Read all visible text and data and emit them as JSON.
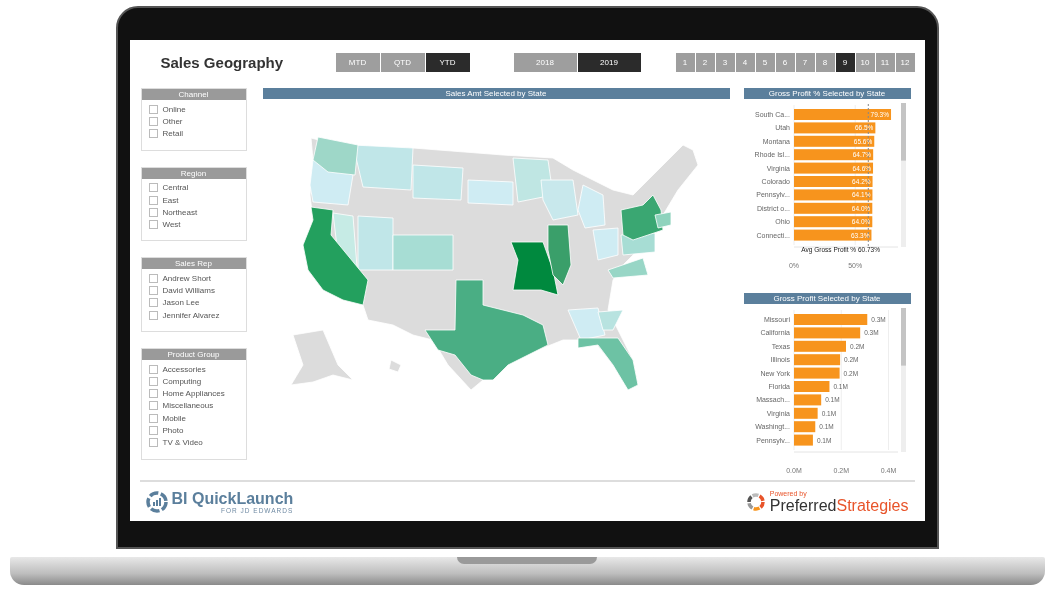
{
  "header": {
    "title": "Sales Geography",
    "periods": [
      {
        "label": "MTD",
        "selected": false
      },
      {
        "label": "QTD",
        "selected": false
      },
      {
        "label": "YTD",
        "selected": true
      }
    ],
    "years": [
      {
        "label": "2018",
        "selected": false
      },
      {
        "label": "2019",
        "selected": true
      }
    ],
    "months": [
      {
        "label": "1",
        "selected": false
      },
      {
        "label": "2",
        "selected": false
      },
      {
        "label": "3",
        "selected": false
      },
      {
        "label": "4",
        "selected": false
      },
      {
        "label": "5",
        "selected": false
      },
      {
        "label": "6",
        "selected": false
      },
      {
        "label": "7",
        "selected": false
      },
      {
        "label": "8",
        "selected": false
      },
      {
        "label": "9",
        "selected": true
      },
      {
        "label": "10",
        "selected": false
      },
      {
        "label": "11",
        "selected": false
      },
      {
        "label": "12",
        "selected": false
      }
    ]
  },
  "filters": [
    {
      "title": "Channel",
      "items": [
        {
          "label": "Online",
          "checked": false
        },
        {
          "label": "Other",
          "checked": false
        },
        {
          "label": "Retail",
          "checked": false
        }
      ]
    },
    {
      "title": "Region",
      "items": [
        {
          "label": "Central",
          "checked": false
        },
        {
          "label": "East",
          "checked": false
        },
        {
          "label": "Northeast",
          "checked": false
        },
        {
          "label": "West",
          "checked": false
        }
      ]
    },
    {
      "title": "Sales Rep",
      "items": [
        {
          "label": "Andrew Short",
          "checked": false
        },
        {
          "label": "David Williams",
          "checked": false
        },
        {
          "label": "Jason Lee",
          "checked": false
        },
        {
          "label": "Jennifer Alvarez",
          "checked": false
        }
      ]
    },
    {
      "title": "Product Group",
      "items": [
        {
          "label": "Accessories",
          "checked": false
        },
        {
          "label": "Computing",
          "checked": false
        },
        {
          "label": "Home Appliances",
          "checked": false
        },
        {
          "label": "Miscellaneous",
          "checked": false
        },
        {
          "label": "Mobile",
          "checked": false
        },
        {
          "label": "Photo",
          "checked": false
        },
        {
          "label": "TV & Video",
          "checked": false
        }
      ]
    }
  ],
  "map": {
    "title": "Sales Amt Selected by State"
  },
  "charts": [
    {
      "title": "Gross Profit % Selected by State",
      "kind": "inside",
      "chart_data": {
        "type": "bar",
        "orientation": "horizontal",
        "categories": [
          "South Ca...",
          "Utah",
          "Montana",
          "Rhode Isl...",
          "Virginia",
          "Colorado",
          "Pennsylv...",
          "District o...",
          "Ohio",
          "Connecti..."
        ],
        "series": [
          {
            "color": "#f7941d",
            "values": [
              79.3,
              66.5,
              65.6,
              64.7,
              64.6,
              64.2,
              64.1,
              64.0,
              64.0,
              63.3
            ]
          }
        ],
        "value_labels": [
          "79.3%",
          "66.5%",
          "65.6%",
          "64.7%",
          "64.6%",
          "64.2%",
          "64.1%",
          "64.0%",
          "64.0%",
          "63.3%"
        ],
        "xlim": [
          0,
          85
        ],
        "xticks": [
          {
            "value": 0,
            "label": "0%"
          },
          {
            "value": 50,
            "label": "50%"
          }
        ],
        "ref_lines": [
          {
            "axis": "x",
            "value": 60.73,
            "label": "Avg Gross Profit % 60.73%"
          }
        ]
      }
    },
    {
      "title": "Gross Profit Selected by State",
      "kind": "outside",
      "chart_data": {
        "type": "bar",
        "orientation": "horizontal",
        "categories": [
          "Missouri",
          "California",
          "Texas",
          "Illinois",
          "New York",
          "Florida",
          "Massach...",
          "Virginia",
          "Washingt...",
          "Pennsylv..."
        ],
        "series": [
          {
            "color": "#f7941d",
            "values": [
              0.31,
              0.28,
              0.22,
              0.195,
              0.193,
              0.15,
              0.115,
              0.1,
              0.09,
              0.08
            ]
          }
        ],
        "value_labels": [
          "0.3M",
          "0.3M",
          "0.2M",
          "0.2M",
          "0.2M",
          "0.1M",
          "0.1M",
          "0.1M",
          "0.1M",
          "0.1M"
        ],
        "xlim": [
          0,
          0.44
        ],
        "xticks": [
          {
            "value": 0,
            "label": "0.0M"
          },
          {
            "value": 0.2,
            "label": "0.2M"
          },
          {
            "value": 0.4,
            "label": "0.4M"
          }
        ]
      }
    }
  ],
  "footer": {
    "brand": "BI QuickLaunch",
    "brand_sub": "FOR JD EDWARDS",
    "powered_by": "Powered by",
    "partner_name": "Preferred",
    "partner_name_2": "Strategies"
  }
}
